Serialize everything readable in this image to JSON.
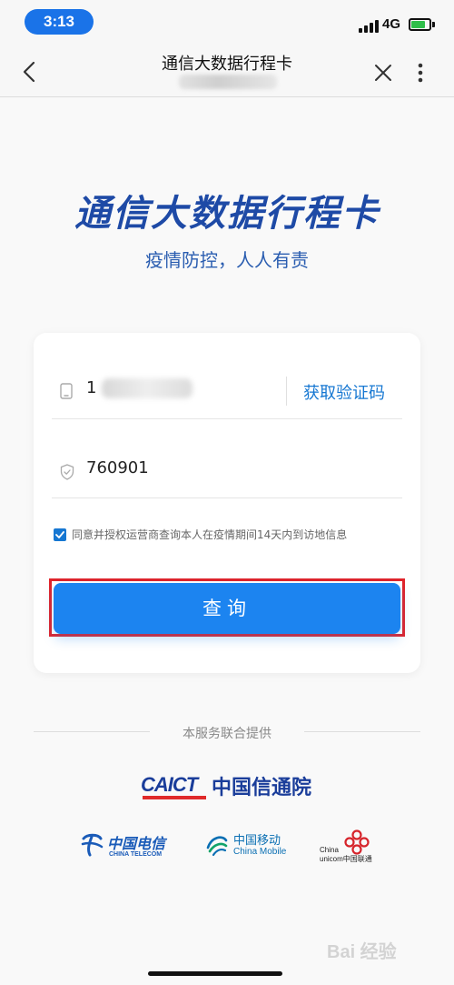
{
  "status_bar": {
    "time": "3:13",
    "network": "4G",
    "battery_level": 0.8
  },
  "nav": {
    "title": "通信大数据行程卡",
    "back_icon": "chevron-left-icon",
    "close_icon": "close-icon",
    "more_icon": "more-vertical-icon"
  },
  "hero": {
    "title": "通信大数据行程卡",
    "subtitle": "疫情防控，人人有责"
  },
  "form": {
    "phone_prefix": "1",
    "get_code_label": "获取验证码",
    "code_value": "760901",
    "agree_checked": true,
    "agree_text": "同意并授权运营商查询本人在疫情期间14天内到访地信息",
    "submit_label": "查询"
  },
  "footer": {
    "provided_by": "本服务联合提供",
    "caict_en": "CAICT",
    "caict_cn": "中国信通院",
    "telecom_cn": "中国电信",
    "telecom_en": "CHINA TELECOM",
    "mobile_cn": "中国移动",
    "mobile_en": "China Mobile",
    "unicom_en1": "China",
    "unicom_en2": "unicom中国联通"
  },
  "watermark": "Bai 经验",
  "colors": {
    "accent": "#1c84f0",
    "title_blue": "#1e4aa6",
    "highlight_red": "#e0242b"
  }
}
